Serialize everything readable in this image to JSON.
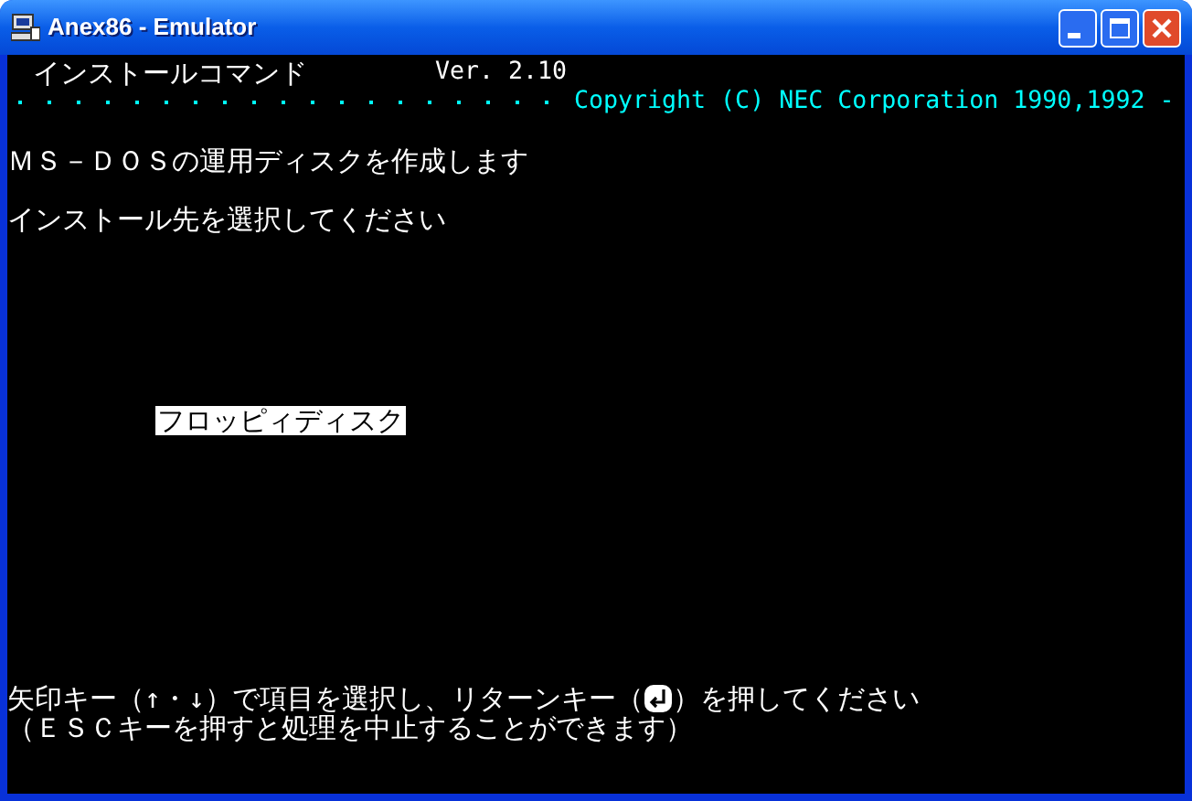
{
  "window": {
    "title": "Anex86 - Emulator"
  },
  "header": {
    "title": "インストールコマンド",
    "version": "Ver. 2.10",
    "copyright": "Copyright (C) NEC Corporation 1990,1992 -"
  },
  "messages": [
    "ＭＳ－ＤＯＳの運用ディスクを作成します",
    "インストール先を選択してください"
  ],
  "options": [
    {
      "label": "フロッピィディスク",
      "selected": true
    }
  ],
  "help": {
    "before_key": "矢印キー（↑・↓）で項目を選択し、リターンキー（",
    "after_key": "）を押してください",
    "note": "（ＥＳＣキーを押すと処理を中止することができます）"
  }
}
